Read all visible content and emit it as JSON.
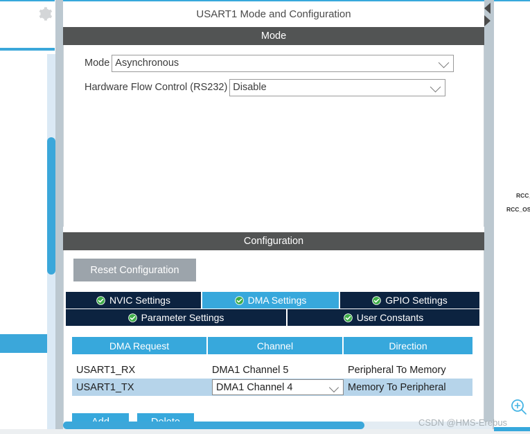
{
  "window": {
    "panel_title": "USART1 Mode and Configuration"
  },
  "sidebar": {
    "gear_icon": "gear-icon"
  },
  "mode_section": {
    "header": "Mode",
    "fields": [
      {
        "label": "Mode",
        "value": "Asynchronous"
      },
      {
        "label": "Hardware Flow Control (RS232)",
        "value": "Disable"
      }
    ]
  },
  "configuration_section": {
    "header": "Configuration",
    "reset_button": "Reset Configuration",
    "tabs_row1": [
      {
        "label": "NVIC Settings",
        "active": false,
        "icon": "check-circle-icon"
      },
      {
        "label": "DMA Settings",
        "active": true,
        "icon": "check-circle-icon"
      },
      {
        "label": "GPIO Settings",
        "active": false,
        "icon": "check-circle-icon"
      }
    ],
    "tabs_row2": [
      {
        "label": "Parameter Settings",
        "active": false,
        "icon": "check-circle-icon"
      },
      {
        "label": "User Constants",
        "active": false,
        "icon": "check-circle-icon"
      }
    ],
    "dma_table": {
      "columns": [
        "DMA Request",
        "Channel",
        "Direction"
      ],
      "rows": [
        {
          "request": "USART1_RX",
          "channel": "DMA1 Channel 5",
          "direction": "Peripheral To Memory",
          "selected": false
        },
        {
          "request": "USART1_TX",
          "channel": "DMA1 Channel 4",
          "direction": "Memory To Peripheral",
          "selected": true
        }
      ]
    },
    "buttons": {
      "add": "Add",
      "delete": "Delete"
    }
  },
  "pinout": {
    "labels": [
      "RCC_",
      "RCC_OS"
    ],
    "zoom_icon": "zoom-in-icon"
  },
  "watermark": "CSDN @HMS-Erebus",
  "colors": {
    "accent_blue": "#37a8dc",
    "tab_navy": "#0c2340",
    "section_header_gray": "#525454",
    "selected_row": "#b6d4ea",
    "check_green": "#3fae49"
  }
}
